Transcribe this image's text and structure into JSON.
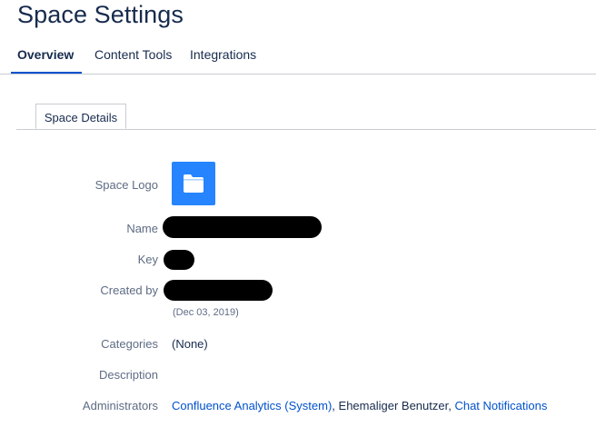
{
  "page": {
    "title": "Space Settings"
  },
  "tabs": [
    {
      "label": "Overview",
      "active": true
    },
    {
      "label": "Content Tools",
      "active": false
    },
    {
      "label": "Integrations",
      "active": false
    }
  ],
  "subtab": {
    "label": "Space Details"
  },
  "details": {
    "logo_label": "Space Logo",
    "logo_icon": "folder-icon",
    "logo_color": "#2684ff",
    "name_label": "Name",
    "key_label": "Key",
    "created_label": "Created by",
    "created_date": "(Dec 03, 2019)",
    "categories_label": "Categories",
    "categories_value": "(None)",
    "description_label": "Description",
    "administrators_label": "Administrators",
    "administrators": {
      "first": "Confluence Analytics (System)",
      "sep1": ", ",
      "second": "Ehemaliger Benutzer",
      "sep2": ", ",
      "third": "Chat Notifications"
    }
  },
  "colors": {
    "link": "#0052cc",
    "active_tab_underline": "#0052cc",
    "text": "#172b4d",
    "label": "#5e6c84"
  }
}
